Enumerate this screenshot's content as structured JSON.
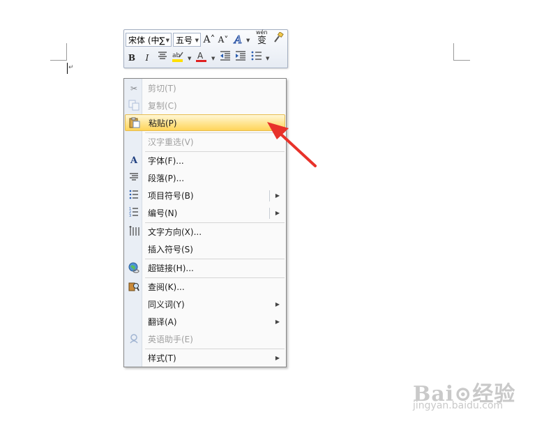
{
  "mini_toolbar": {
    "font_name": "宋体 (中∑",
    "font_size": "五号",
    "grow_font_icon": "A˄",
    "shrink_font_icon": "A˅",
    "bold": "B",
    "italic": "I",
    "font_color_letter": "A",
    "phonetic_label": "wén",
    "phonetic_char": "变"
  },
  "context_menu": {
    "items": [
      {
        "label": "剪切(T)",
        "icon": "scissors-icon",
        "disabled": true
      },
      {
        "label": "复制(C)",
        "icon": "copy-icon",
        "disabled": true
      },
      {
        "label": "粘贴(P)",
        "icon": "paste-icon",
        "highlighted": true
      },
      {
        "label": "汉字重选(V)",
        "disabled": true
      },
      {
        "label": "字体(F)...",
        "icon": "font-icon"
      },
      {
        "label": "段落(P)...",
        "icon": "paragraph-icon"
      },
      {
        "label": "项目符号(B)",
        "icon": "bullets-icon",
        "submenu": true
      },
      {
        "label": "编号(N)",
        "icon": "numbering-icon",
        "submenu": true
      },
      {
        "label": "文字方向(X)...",
        "icon": "text-direction-icon"
      },
      {
        "label": "插入符号(S)"
      },
      {
        "label": "超链接(H)...",
        "icon": "hyperlink-icon"
      },
      {
        "label": "查阅(K)...",
        "icon": "research-icon"
      },
      {
        "label": "同义词(Y)",
        "submenu": true
      },
      {
        "label": "翻译(A)",
        "submenu": true
      },
      {
        "label": "英语助手(E)",
        "icon": "english-assistant-icon",
        "disabled": true
      },
      {
        "label": "样式(T)",
        "submenu": true
      }
    ]
  },
  "colors": {
    "highlight": "#ffe48f",
    "annotation_arrow": "#e8322a",
    "font_color_bar": "#e02020",
    "highlight_bar": "#ffe000"
  },
  "watermark": {
    "brand": "Bai⊙经验",
    "url": "jingyan.baidu.com"
  }
}
